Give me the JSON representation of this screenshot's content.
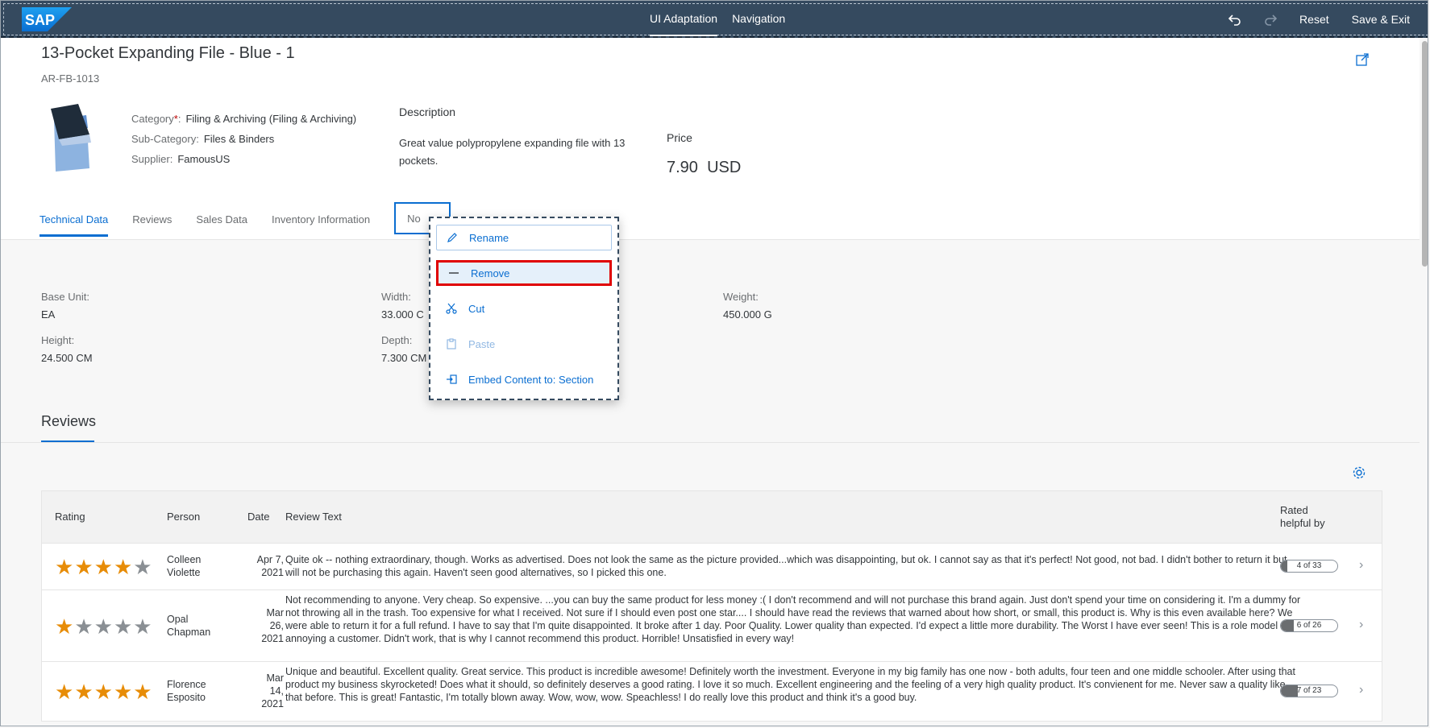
{
  "shell": {
    "logo_text": "SAP",
    "tabs": [
      {
        "label": "UI Adaptation"
      },
      {
        "label": "Navigation"
      }
    ],
    "reset_label": "Reset",
    "save_exit_label": "Save & Exit",
    "colors": {
      "bar": "#354a5f",
      "accent": "#0a6ed1"
    }
  },
  "header": {
    "title": "13-Pocket Expanding File - Blue - 1",
    "subtitle": "AR-FB-1013",
    "category_label": "Category",
    "category_required": "*",
    "category_value": "Filing & Archiving (Filing & Archiving)",
    "subcategory_label": "Sub-Category:",
    "subcategory_value": "Files & Binders",
    "supplier_label": "Supplier:",
    "supplier_value": "FamousUS",
    "description_heading": "Description",
    "description_text": "Great value polypropylene expanding file with 13 pockets.",
    "price_heading": "Price",
    "price_value": "7.90",
    "price_currency": "USD"
  },
  "tabs": [
    {
      "label": "Technical Data"
    },
    {
      "label": "Reviews"
    },
    {
      "label": "Sales Data"
    },
    {
      "label": "Inventory Information"
    },
    {
      "label": "No"
    }
  ],
  "tech": {
    "base_unit_label": "Base Unit:",
    "base_unit_value": "EA",
    "width_label": "Width:",
    "width_value": "33.000 C",
    "weight_label": "Weight:",
    "weight_value": "450.000 G",
    "height_label": "Height:",
    "height_value": "24.500 CM",
    "depth_label": "Depth:",
    "depth_value": "7.300 CM"
  },
  "reviews": {
    "heading": "Reviews",
    "columns": {
      "rating": "Rating",
      "person": "Person",
      "date": "Date",
      "text": "Review Text",
      "helpful_1": "Rated",
      "helpful_2": "helpful by"
    },
    "rows": [
      {
        "rating": 4,
        "person_1": "Colleen",
        "person_2": "Violette",
        "date_1": "Apr 7,",
        "date_2": "2021",
        "date_3": "",
        "text": "Quite ok -- nothing extraordinary, though. Works as advertised. Does not look the same as the picture provided...which was disappointing, but ok. I cannot say as that it's perfect! Not good, not bad. I didn't bother to return it but will not be purchasing this again. Haven't seen good alternatives, so I picked this one.",
        "helpful": "4 of 33",
        "helpful_fraction": 0.12
      },
      {
        "rating": 1,
        "person_1": "Opal",
        "person_2": "Chapman",
        "date_1": "Mar",
        "date_2": "26,",
        "date_3": "2021",
        "text": "Not recommending to anyone. Very cheap. So expensive. ...you can buy the same product for less money :( I don't recommend and will not purchase this brand again. Just don't spend your time on considering it. I'm a dummy for not throwing all in the trash. Too expensive for what I received. Not sure if I should even post one star.... I should have read the reviews that warned about how short, or small, this product is. Why is this even available here? We were able to return it for a full refund. I have to say that I'm quite disappointed. It broke after 1 day. Poor Quality. Lower quality than expected. I'd expect a little more durability. The Worst I have ever seen! This is a role model for annoying a customer. Didn't work, that is why I cannot recommend this product. Horrible! Unsatisfied in every way!",
        "helpful": "6 of 26",
        "helpful_fraction": 0.23
      },
      {
        "rating": 5,
        "person_1": "Florence",
        "person_2": "Esposito",
        "date_1": "Mar",
        "date_2": "14,",
        "date_3": "2021",
        "text": "Unique and beautiful. Excellent quality. Great service. This product is incredible awesome! Definitely worth the investment. Everyone in my big family has one now - both adults, four teen and one middle schooler. After using that product my business skyrocketed! Does what it should, so definitely deserves a good rating. I love it so much. Excellent engineering and the feeling of a very high quality product. It's convienent for me. Never saw a quality like that before. This is great! Fantastic, I'm totally blown away. Wow, wow, wow. Speachless! I do really love this product and think it's a good buy.",
        "helpful": "7 of 23",
        "helpful_fraction": 0.3
      }
    ]
  },
  "context_menu": {
    "rename": "Rename",
    "remove": "Remove",
    "cut": "Cut",
    "paste": "Paste",
    "embed": "Embed Content to: Section"
  }
}
